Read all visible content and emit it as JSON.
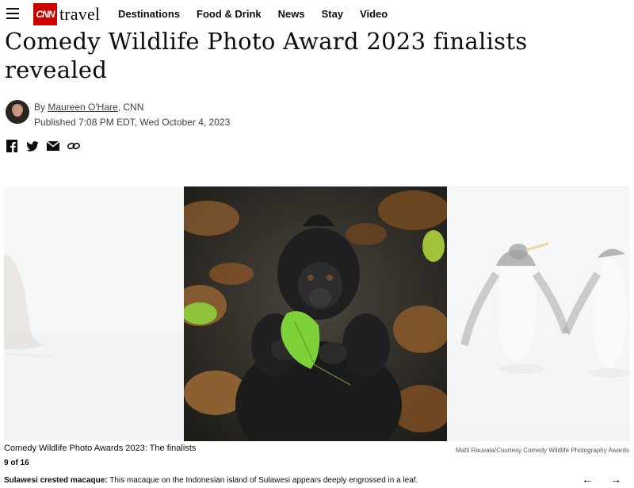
{
  "nav": {
    "brand_cnn": "CNN",
    "brand_section": "travel",
    "links": [
      "Destinations",
      "Food & Drink",
      "News",
      "Stay",
      "Video"
    ]
  },
  "article": {
    "headline": "Comedy Wildlife Photo Award 2023 finalists revealed",
    "byline_prefix": "By ",
    "author": "Maureen O'Hare",
    "byline_suffix": ", CNN",
    "published": "Published 7:08 PM EDT, Wed October 4, 2023"
  },
  "share": {
    "icons": [
      "facebook-icon",
      "twitter-icon",
      "email-icon",
      "link-icon"
    ]
  },
  "gallery": {
    "title": "Comedy Wildlife Photo Awards 2023: The finalists",
    "credit": "Matti Rauvala/Courtesy Comedy Wildlife Photography Awards",
    "counter": "9 of 16",
    "caption_title": "Sulawesi crested macaque:",
    "caption_text": " This macaque on the Indonesian island of Sulawesi appears deeply engrossed in a leaf.",
    "prev": "←",
    "next": "→"
  },
  "colors": {
    "brand_red": "#cc0000",
    "text": "#0c0c0c",
    "muted": "#404040"
  }
}
